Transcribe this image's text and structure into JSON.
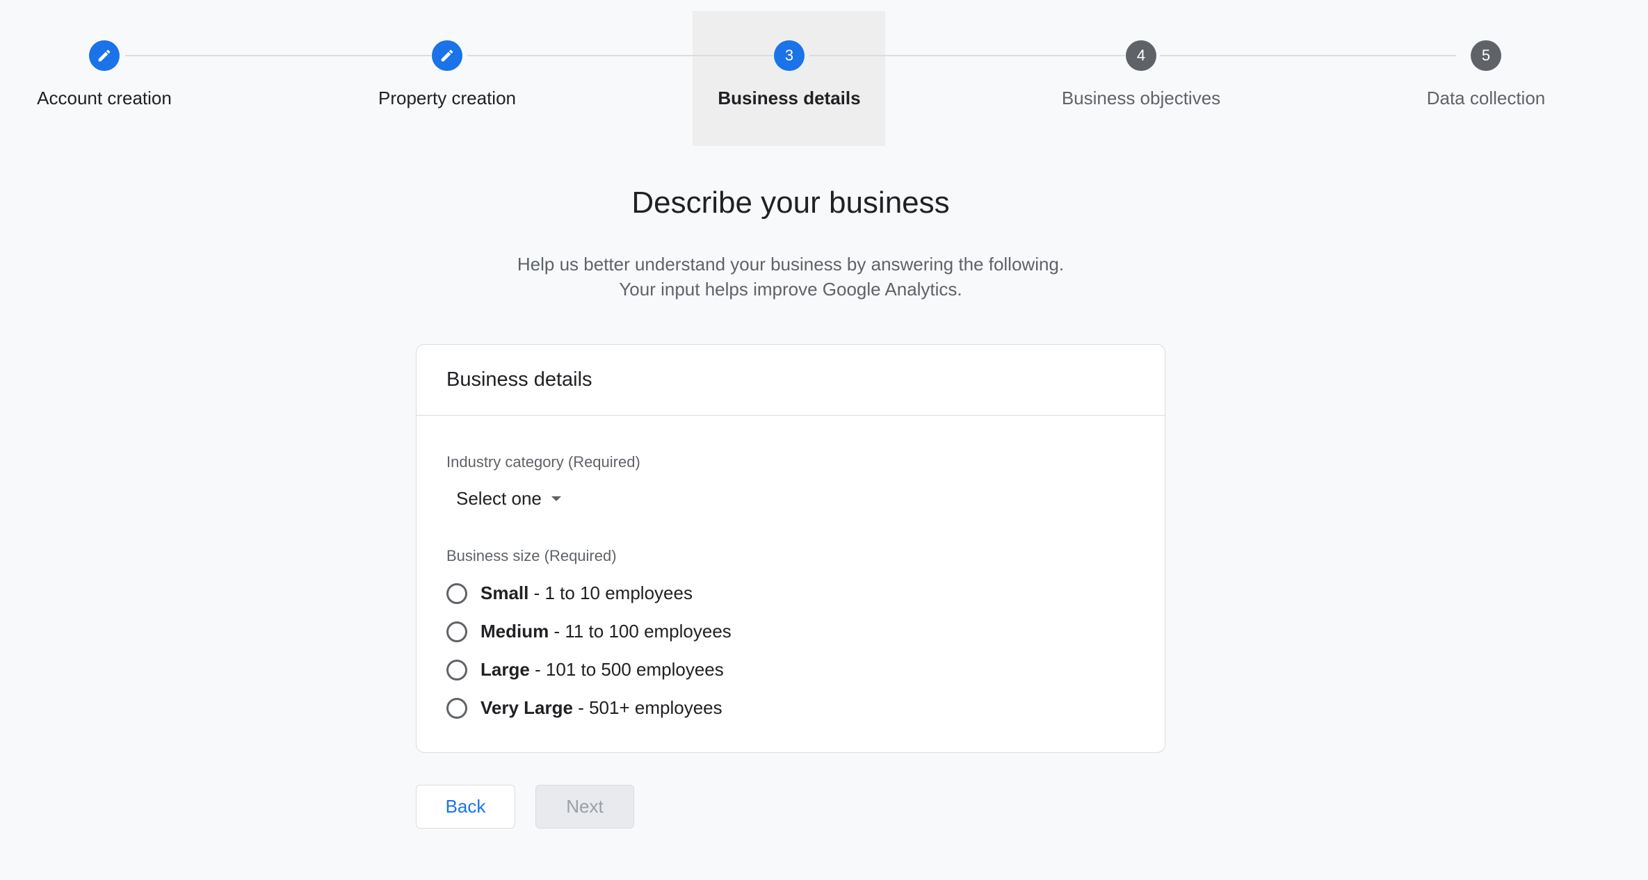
{
  "stepper": {
    "steps": [
      {
        "label": "Account creation",
        "state": "done",
        "icon": "edit-icon"
      },
      {
        "label": "Property creation",
        "state": "done",
        "icon": "edit-icon"
      },
      {
        "label": "Business details",
        "state": "current",
        "number": "3"
      },
      {
        "label": "Business objectives",
        "state": "todo",
        "number": "4"
      },
      {
        "label": "Data collection",
        "state": "todo",
        "number": "5"
      }
    ]
  },
  "heading": {
    "title": "Describe your business",
    "subtitle_line1": "Help us better understand your business by answering the following.",
    "subtitle_line2": "Your input helps improve Google Analytics."
  },
  "card": {
    "title": "Business details",
    "industry": {
      "label": "Industry category (Required)",
      "selected": "Select one"
    },
    "size": {
      "label": "Business size (Required)",
      "options": [
        {
          "name": "Small",
          "detail": " - 1 to 10 employees"
        },
        {
          "name": "Medium",
          "detail": " - 11 to 100 employees"
        },
        {
          "name": "Large",
          "detail": " - 101 to 500 employees"
        },
        {
          "name": "Very Large",
          "detail": " - 501+ employees"
        }
      ]
    }
  },
  "buttons": {
    "back": "Back",
    "next": "Next"
  },
  "colors": {
    "accent": "#1a73e8",
    "pending": "#5f6368",
    "background": "#f8f9fa"
  }
}
